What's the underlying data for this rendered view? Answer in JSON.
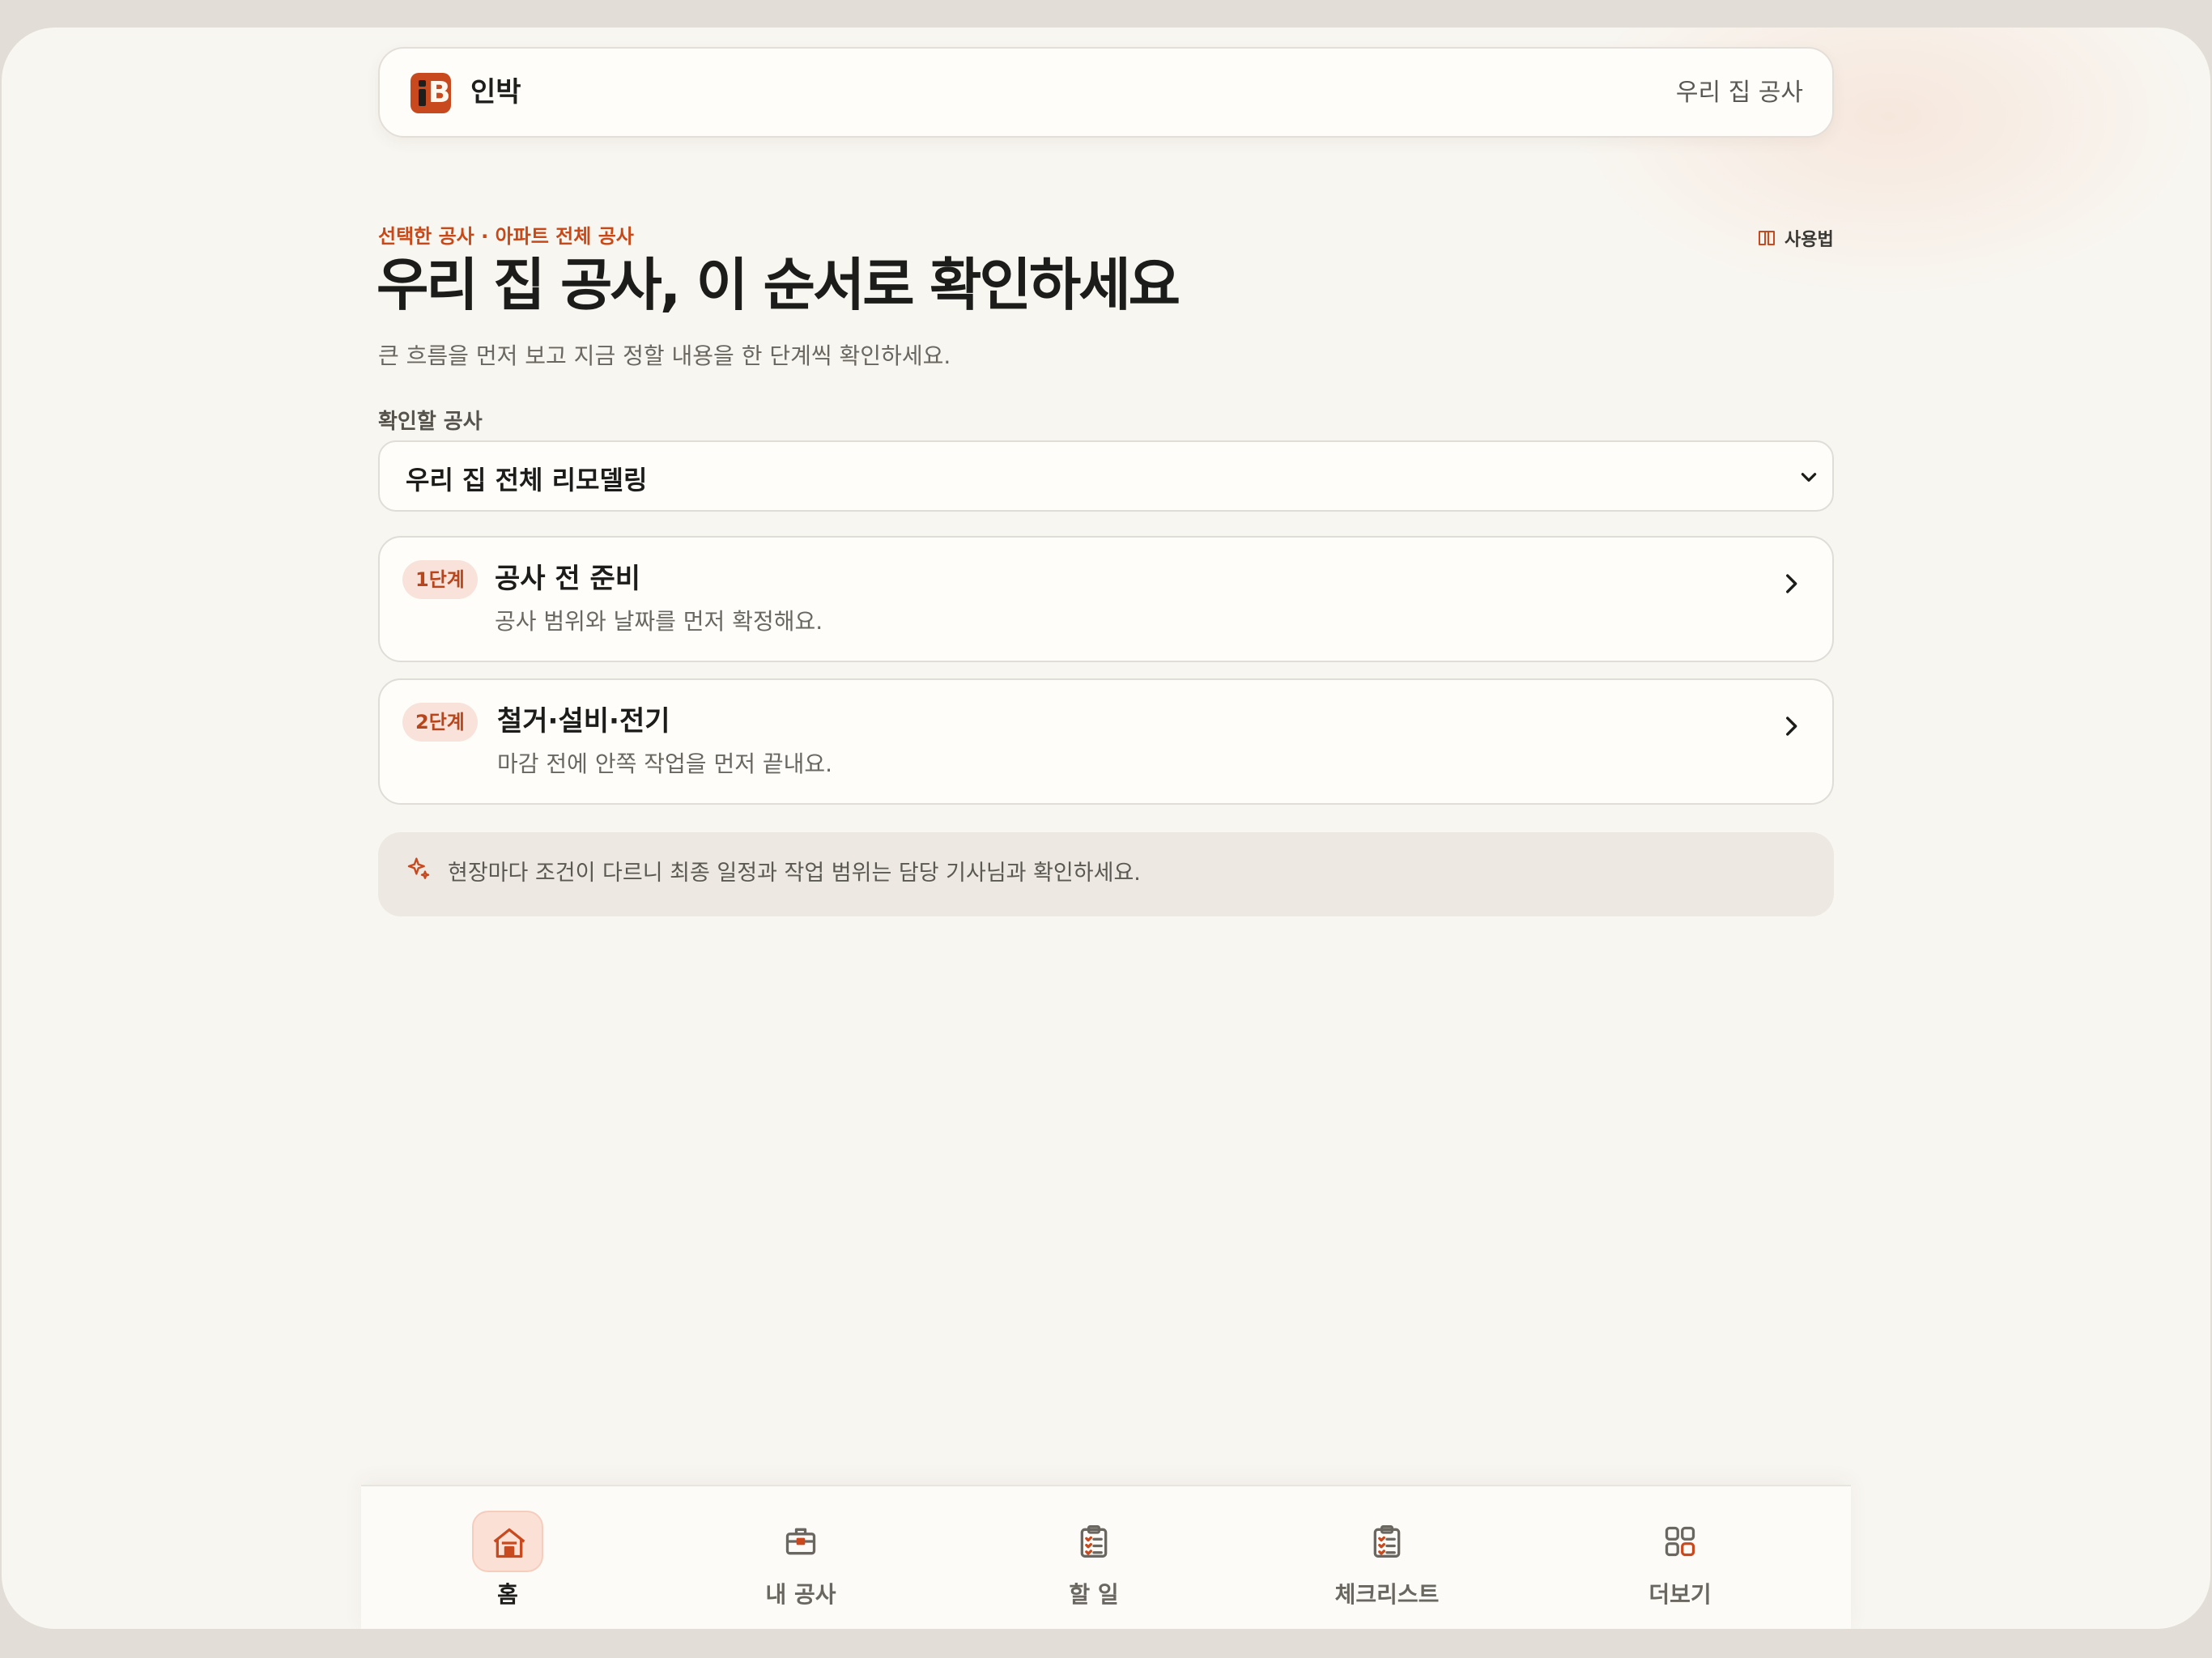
{
  "app": {
    "brand_name": "인박",
    "logo_letter": "B",
    "header_right": "우리 집 공사"
  },
  "hero": {
    "eyebrow": "선택한 공사 · 아파트 전체 공사",
    "guide_label": "사용법",
    "title": "우리 집 공사, 이 순서로 확인하세요",
    "subtitle": "큰 흐름을 먼저 보고 지금 정할 내용을 한 단계씩 확인하세요."
  },
  "project_select": {
    "label": "확인할 공사",
    "value": "우리 집 전체 리모델링"
  },
  "steps": [
    {
      "badge": "1단계",
      "title": "공사 전 준비",
      "desc": "공사 범위와 날짜를 먼저 확정해요."
    },
    {
      "badge": "2단계",
      "title": "철거·설비·전기",
      "desc": "마감 전에 안쪽 작업을 먼저 끝내요."
    }
  ],
  "notice": {
    "icon": "sparkle-icon",
    "text": "현장마다 조건이 다르니 최종 일정과 작업 범위는 담당 기사님과 확인하세요."
  },
  "tabbar": {
    "tabs": [
      {
        "label": "홈",
        "icon": "home-icon",
        "active": true
      },
      {
        "label": "내 공사",
        "icon": "toolbox-icon",
        "active": false
      },
      {
        "label": "할 일",
        "icon": "clipboard-icon",
        "active": false
      },
      {
        "label": "체크리스트",
        "icon": "checklist-icon",
        "active": false
      },
      {
        "label": "더보기",
        "icon": "grid-icon",
        "active": false
      }
    ]
  },
  "colors": {
    "accent": "#c9491f",
    "background": "#f8f6f1",
    "badge_bg": "#f9e2d9",
    "notice_bg": "#ede8e2"
  }
}
